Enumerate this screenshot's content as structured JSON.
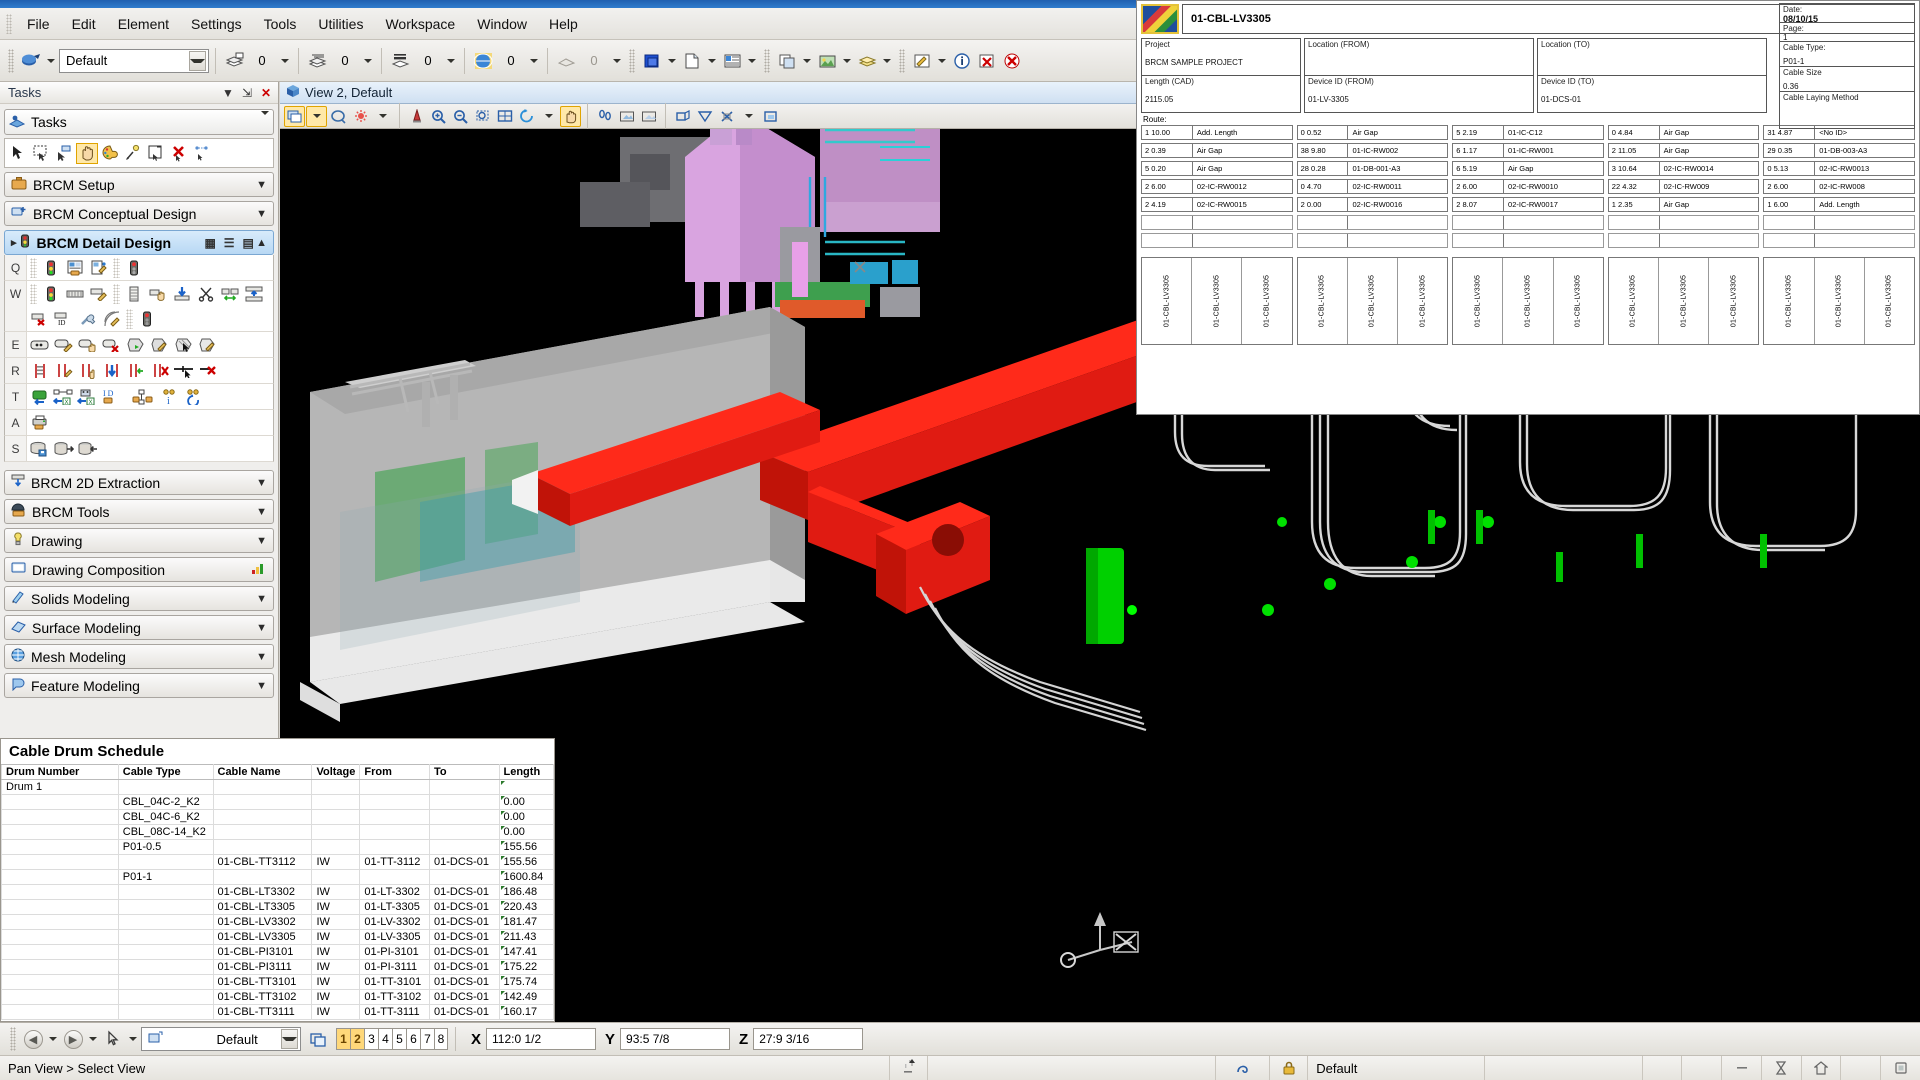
{
  "app": {
    "menus": [
      "File",
      "Edit",
      "Element",
      "Settings",
      "Tools",
      "Utilities",
      "Workspace",
      "Window",
      "Help"
    ],
    "toolbar": {
      "style_value": "Default",
      "level_value": "0",
      "color_value": "0",
      "weight_value": "0",
      "style2_value": "0",
      "transparency_value": "0"
    }
  },
  "tasks": {
    "panel_title": "Tasks",
    "task_selector": "Tasks",
    "sections": [
      {
        "label": "BRCM Setup",
        "icon": "briefcase-icon",
        "expanded": false
      },
      {
        "label": "BRCM Conceptual Design",
        "icon": "conceptual-icon",
        "expanded": false
      },
      {
        "label": "BRCM Detail Design",
        "icon": "detail-design-icon",
        "expanded": true
      },
      {
        "label": "BRCM 2D Extraction",
        "icon": "extraction-icon",
        "expanded": false
      },
      {
        "label": "BRCM Tools",
        "icon": "tools-icon",
        "expanded": false
      },
      {
        "label": "Drawing",
        "icon": "drawing-icon",
        "expanded": false
      },
      {
        "label": "Drawing Composition",
        "icon": "composition-icon",
        "expanded": false
      },
      {
        "label": "Solids Modeling",
        "icon": "solids-icon",
        "expanded": false
      },
      {
        "label": "Surface Modeling",
        "icon": "surface-icon",
        "expanded": false
      },
      {
        "label": "Mesh Modeling",
        "icon": "mesh-icon",
        "expanded": false
      },
      {
        "label": "Feature Modeling",
        "icon": "feature-icon",
        "expanded": false
      }
    ],
    "detail_rows": [
      {
        "key": "Q",
        "count": 5
      },
      {
        "key": "W",
        "count": 10
      },
      {
        "key": "W2",
        "count": 5
      },
      {
        "key": "E",
        "count": 8
      },
      {
        "key": "R",
        "count": 8
      },
      {
        "key": "T",
        "count": 7
      },
      {
        "key": "A",
        "count": 1
      },
      {
        "key": "S",
        "count": 3
      }
    ]
  },
  "view": {
    "title": "View 2, Default",
    "icon": "view-cube-icon"
  },
  "schedule": {
    "title": "Cable Drum Schedule",
    "columns": [
      "Drum Number",
      "Cable Type",
      "Cable Name",
      "Voltage",
      "From",
      "To",
      "Length"
    ],
    "rows": [
      {
        "drum": "Drum 1",
        "type": "",
        "name": "",
        "voltage": "",
        "from": "",
        "to": "",
        "length": ""
      },
      {
        "drum": "",
        "type": "CBL_04C-2_K2",
        "name": "",
        "voltage": "",
        "from": "",
        "to": "",
        "length": "0.00"
      },
      {
        "drum": "",
        "type": "CBL_04C-6_K2",
        "name": "",
        "voltage": "",
        "from": "",
        "to": "",
        "length": "0.00"
      },
      {
        "drum": "",
        "type": "CBL_08C-14_K2",
        "name": "",
        "voltage": "",
        "from": "",
        "to": "",
        "length": "0.00"
      },
      {
        "drum": "",
        "type": "P01-0.5",
        "name": "",
        "voltage": "",
        "from": "",
        "to": "",
        "length": "155.56"
      },
      {
        "drum": "",
        "type": "",
        "name": "01-CBL-TT3112",
        "voltage": "IW",
        "from": "01-TT-3112",
        "to": "01-DCS-01",
        "length": "155.56"
      },
      {
        "drum": "",
        "type": "P01-1",
        "name": "",
        "voltage": "",
        "from": "",
        "to": "",
        "length": "1600.84"
      },
      {
        "drum": "",
        "type": "",
        "name": "01-CBL-LT3302",
        "voltage": "IW",
        "from": "01-LT-3302",
        "to": "01-DCS-01",
        "length": "186.48"
      },
      {
        "drum": "",
        "type": "",
        "name": "01-CBL-LT3305",
        "voltage": "IW",
        "from": "01-LT-3305",
        "to": "01-DCS-01",
        "length": "220.43"
      },
      {
        "drum": "",
        "type": "",
        "name": "01-CBL-LV3302",
        "voltage": "IW",
        "from": "01-LV-3302",
        "to": "01-DCS-01",
        "length": "181.47"
      },
      {
        "drum": "",
        "type": "",
        "name": "01-CBL-LV3305",
        "voltage": "IW",
        "from": "01-LV-3305",
        "to": "01-DCS-01",
        "length": "211.43"
      },
      {
        "drum": "",
        "type": "",
        "name": "01-CBL-PI3101",
        "voltage": "IW",
        "from": "01-PI-3101",
        "to": "01-DCS-01",
        "length": "147.41"
      },
      {
        "drum": "",
        "type": "",
        "name": "01-CBL-PI3111",
        "voltage": "IW",
        "from": "01-PI-3111",
        "to": "01-DCS-01",
        "length": "175.22"
      },
      {
        "drum": "",
        "type": "",
        "name": "01-CBL-TT3101",
        "voltage": "IW",
        "from": "01-TT-3101",
        "to": "01-DCS-01",
        "length": "175.74"
      },
      {
        "drum": "",
        "type": "",
        "name": "01-CBL-TT3102",
        "voltage": "IW",
        "from": "01-TT-3102",
        "to": "01-DCS-01",
        "length": "142.49"
      },
      {
        "drum": "",
        "type": "",
        "name": "01-CBL-TT3111",
        "voltage": "IW",
        "from": "01-TT-3111",
        "to": "01-DCS-01",
        "length": "160.17"
      }
    ]
  },
  "report": {
    "cable_name": "01-CBL-LV3305",
    "logo": "brcm-logo-icon",
    "date_label": "Date:",
    "date_value": "08/10/15",
    "page_label": "Page:",
    "page_value": "1",
    "cable_type_label": "Cable Type:",
    "cable_type_value": "P01-1",
    "cable_size_label": "Cable Size",
    "cable_size_value": "0.36",
    "laying_method_label": "Cable Laying Method",
    "laying_method_value": "",
    "project_label": "Project",
    "project_value": "BRCM SAMPLE PROJECT",
    "length_cad_label": "Length (CAD)",
    "length_cad_value": "2115.05",
    "location_from_label": "Location (FROM)",
    "location_from_value": "",
    "device_from_label": "Device ID (FROM)",
    "device_from_value": "01-LV-3305",
    "location_to_label": "Location (TO)",
    "location_to_value": "",
    "device_to_label": "Device ID (TO)",
    "device_to_value": "01-DCS-01",
    "route_label": "Route:",
    "route_rows": [
      [
        {
          "v": "1 10.00",
          "n": "Add. Length"
        },
        {
          "v": "0 0.52",
          "n": "Air Gap"
        },
        {
          "v": "5 2.19",
          "n": "01-IC-C12"
        },
        {
          "v": "0 4.84",
          "n": "Air Gap"
        },
        {
          "v": "31 4.87",
          "n": "<No ID>"
        }
      ],
      [
        {
          "v": "2 0.39",
          "n": "Air Gap"
        },
        {
          "v": "38 9.80",
          "n": "01-IC-RW002"
        },
        {
          "v": "6 1.17",
          "n": "01-IC-RW001"
        },
        {
          "v": "2 11.05",
          "n": "Air Gap"
        },
        {
          "v": "29 0.35",
          "n": "01-DB-003-A3"
        }
      ],
      [
        {
          "v": "5 0.20",
          "n": "Air Gap"
        },
        {
          "v": "28 0.28",
          "n": "01-DB-001-A3"
        },
        {
          "v": "6 5.19",
          "n": "Air Gap"
        },
        {
          "v": "3 10.64",
          "n": "02-IC-RW0014"
        },
        {
          "v": "0 5.13",
          "n": "02-IC-RW0013"
        }
      ],
      [
        {
          "v": "2 6.00",
          "n": "02-IC-RW0012"
        },
        {
          "v": "0 4.70",
          "n": "02-IC-RW0011"
        },
        {
          "v": "2 6.00",
          "n": "02-IC-RW0010"
        },
        {
          "v": "22 4.32",
          "n": "02-IC-RW009"
        },
        {
          "v": "2 6.00",
          "n": "02-IC-RW008"
        }
      ],
      [
        {
          "v": "2 4.19",
          "n": "02-IC-RW0015"
        },
        {
          "v": "2 0.00",
          "n": "02-IC-RW0016"
        },
        {
          "v": "2 8.07",
          "n": "02-IC-RW0017"
        },
        {
          "v": "1 2.35",
          "n": "Air Gap"
        },
        {
          "v": "1 6.00",
          "n": "Add. Length"
        }
      ],
      [
        {
          "v": "",
          "n": ""
        },
        {
          "v": "",
          "n": ""
        },
        {
          "v": "",
          "n": ""
        },
        {
          "v": "",
          "n": ""
        },
        {
          "v": "",
          "n": ""
        }
      ],
      [
        {
          "v": "",
          "n": ""
        },
        {
          "v": "",
          "n": ""
        },
        {
          "v": "",
          "n": ""
        },
        {
          "v": "",
          "n": ""
        },
        {
          "v": "",
          "n": ""
        }
      ]
    ],
    "vertical_label": "01-CBL-LV3305",
    "vertical_groups": 5,
    "vertical_per_group": 3
  },
  "bottombar": {
    "model_value": "Default",
    "levels": [
      "1",
      "2",
      "3",
      "4",
      "5",
      "6",
      "7",
      "8"
    ],
    "levels_selected": [
      "1",
      "2"
    ],
    "x_label": "X",
    "x_value": "112:0 1/2",
    "y_label": "Y",
    "y_value": "93:5 7/8",
    "z_label": "Z",
    "z_value": "27:9 3/16"
  },
  "statusbar": {
    "message": "Pan View > Select View",
    "lock_icon": "lock-icon",
    "snap_icon": "snap-icon",
    "level_value": "Default"
  },
  "colors": {
    "accent": "#2f7ccd",
    "highlight": "#ffd87a",
    "section_active": "#b8d8f4",
    "cable_red": "#e01b12",
    "cable_green": "#00d000"
  }
}
